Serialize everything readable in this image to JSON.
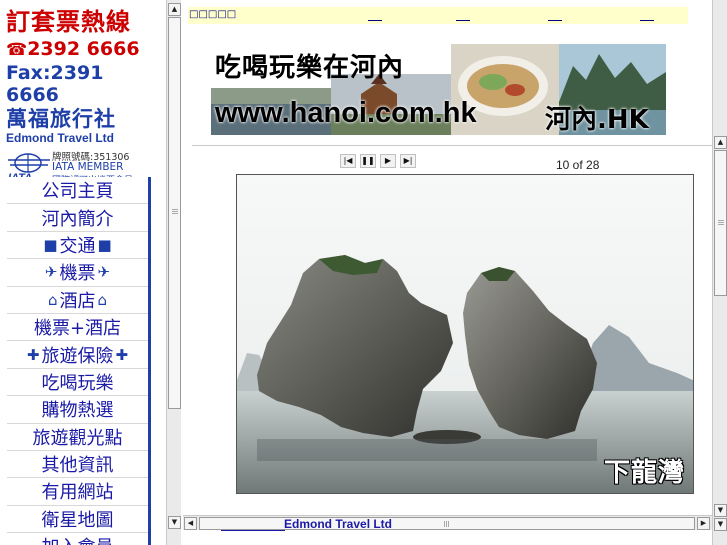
{
  "promo": {
    "hotline": "套票熱線",
    "hotline_prefix": "訂",
    "phone_label": "☎",
    "phone": "2392 6666",
    "fax": "Fax:2391 6666",
    "agency_zh": "萬福旅行社",
    "agency_en": "Edmond Travel Ltd",
    "license": "牌照號碼:351306",
    "iata_member": "IATA MEMBER",
    "iata_sub": "國際認可出機票會員",
    "iata_logo_text": "IATA"
  },
  "menu": {
    "items": [
      {
        "label": "公司主頁",
        "icon": ""
      },
      {
        "label": "河內簡介",
        "icon": ""
      },
      {
        "label": "交通",
        "icon": "bus-icon",
        "glyph": "🚌"
      },
      {
        "label": "機票",
        "icon": "plane-icon",
        "glyph": "✈"
      },
      {
        "label": "酒店",
        "icon": "hotel-icon",
        "glyph": "🏨"
      },
      {
        "label": "機票+酒店",
        "icon": ""
      },
      {
        "label": "旅遊保險",
        "icon": "cross-icon",
        "glyph": "✚"
      },
      {
        "label": "吃喝玩樂",
        "icon": ""
      },
      {
        "label": "購物熱選",
        "icon": ""
      },
      {
        "label": "旅遊觀光點",
        "icon": ""
      },
      {
        "label": "其他資訊",
        "icon": ""
      },
      {
        "label": "有用網站",
        "icon": ""
      },
      {
        "label": "衛星地圖",
        "icon": ""
      },
      {
        "label": "加入會員",
        "icon": ""
      }
    ]
  },
  "topbar": {
    "title": "□□□□□"
  },
  "banner": {
    "title": "吃喝玩樂在河內",
    "url": "www.hanoi.com.hk",
    "brand": "河內.HK"
  },
  "slideshow": {
    "counter": "10 of 28",
    "caption": "下龍灣",
    "controls": {
      "first": "⏮",
      "pause": "⏸",
      "play": "▶",
      "last": "⏭"
    }
  },
  "footer": {
    "link": "Edmond Travel Ltd"
  },
  "colors": {
    "brand_blue": "#1e3fa8",
    "brand_red": "#cc0000",
    "link_blue": "#1a1aa6",
    "topbar_bg": "#ffffcc"
  }
}
